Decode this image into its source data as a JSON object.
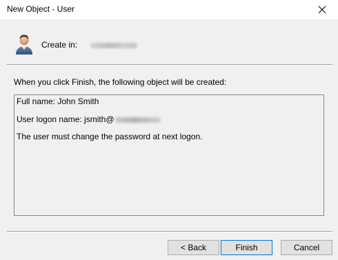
{
  "window": {
    "title": "New Object - User",
    "close_icon": "close-icon"
  },
  "header": {
    "icon": "user-icon",
    "create_in_label": "Create in:"
  },
  "main": {
    "intro": "When you click Finish, the following object will be created:",
    "summary": {
      "full_name": "Full name: John Smith",
      "logon_name_prefix": "User logon name: jsmith@",
      "password_note": "The user must change the password at next logon."
    }
  },
  "buttons": {
    "back": "< Back",
    "finish": "Finish",
    "cancel": "Cancel"
  },
  "colors": {
    "dialog_bg": "#f0f0f0",
    "titlebar_bg": "#ffffff",
    "default_button_border": "#0078d7"
  }
}
